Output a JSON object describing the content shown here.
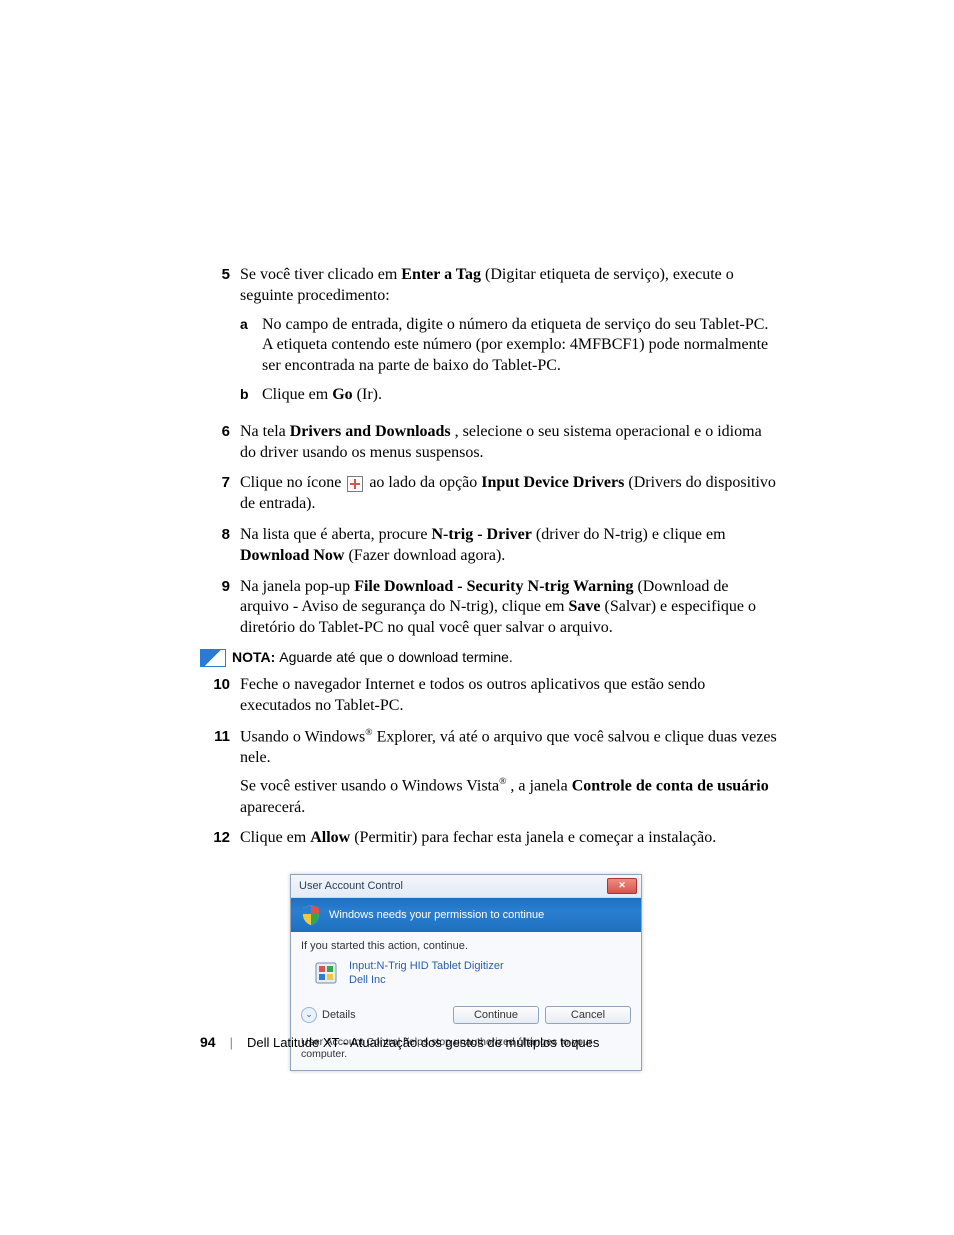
{
  "steps": {
    "s5": {
      "num": "5",
      "text_before": "Se você tiver clicado em ",
      "bold1": "Enter a Tag",
      "text_after": " (Digitar etiqueta de serviço), execute o seguinte procedimento:",
      "a": {
        "letter": "a",
        "text": "No campo de entrada, digite o número da etiqueta de serviço do seu Tablet-PC. A etiqueta contendo este número (por exemplo: 4MFBCF1) pode normalmente ser encontrada na parte de baixo do Tablet-PC."
      },
      "b": {
        "letter": "b",
        "pre": "Clique em ",
        "bold": "Go",
        "post": " (Ir)."
      }
    },
    "s6": {
      "num": "6",
      "pre": "Na tela ",
      "bold": "Drivers and Downloads",
      "post": ", selecione o seu sistema operacional e o idioma do driver usando os menus suspensos."
    },
    "s7": {
      "num": "7",
      "pre": "Clique no ícone ",
      "mid": " ao lado da opção ",
      "bold": "Input Device Drivers",
      "post": " (Drivers do dispositivo de entrada)."
    },
    "s8": {
      "num": "8",
      "pre": "Na lista que é aberta, procure ",
      "bold1": "N-trig - Driver",
      "mid": " (driver do N-trig) e clique em ",
      "bold2": "Download Now",
      "post": " (Fazer download agora)."
    },
    "s9": {
      "num": "9",
      "pre": "Na janela pop-up ",
      "bold1": "File Download - Security N-trig Warning",
      "mid": " (Download de arquivo - Aviso de segurança do N-trig), clique em ",
      "bold2": "Save",
      "post": " (Salvar) e especifique o diretório do Tablet-PC no qual você quer salvar o arquivo."
    },
    "note": {
      "label": "NOTA:",
      "text": " Aguarde até que o download termine."
    },
    "s10": {
      "num": "10",
      "text": "Feche o navegador Internet e todos os outros aplicativos que estão sendo executados no Tablet-PC."
    },
    "s11": {
      "num": "11",
      "p1_pre": "Usando o Windows",
      "p1_reg": "®",
      "p1_post": " Explorer, vá até o arquivo que você salvou e clique duas vezes nele.",
      "p2_pre": "Se você estiver usando o Windows Vista",
      "p2_reg": "®",
      "p2_mid": ", a janela ",
      "p2_bold": "Controle de conta de usuário",
      "p2_post": " aparecerá."
    },
    "s12": {
      "num": "12",
      "pre": "Clique em ",
      "bold": "Allow",
      "post": " (Permitir) para fechar esta janela e começar a instalação."
    }
  },
  "uac": {
    "title": "User Account Control",
    "close": "✕",
    "headline": "Windows needs your permission to continue",
    "started": "If you started this action, continue.",
    "app_line1": "Input:N-Trig HID Tablet Digitizer",
    "app_line2": "Dell Inc",
    "details": "Details",
    "continue": "Continue",
    "cancel": "Cancel",
    "footer": "User Account Control helps stop unauthorized changes to your computer."
  },
  "footer": {
    "page": "94",
    "sep": "|",
    "text": "Dell Latitude XT - Atualização dos gestos de múltiplos toques"
  }
}
